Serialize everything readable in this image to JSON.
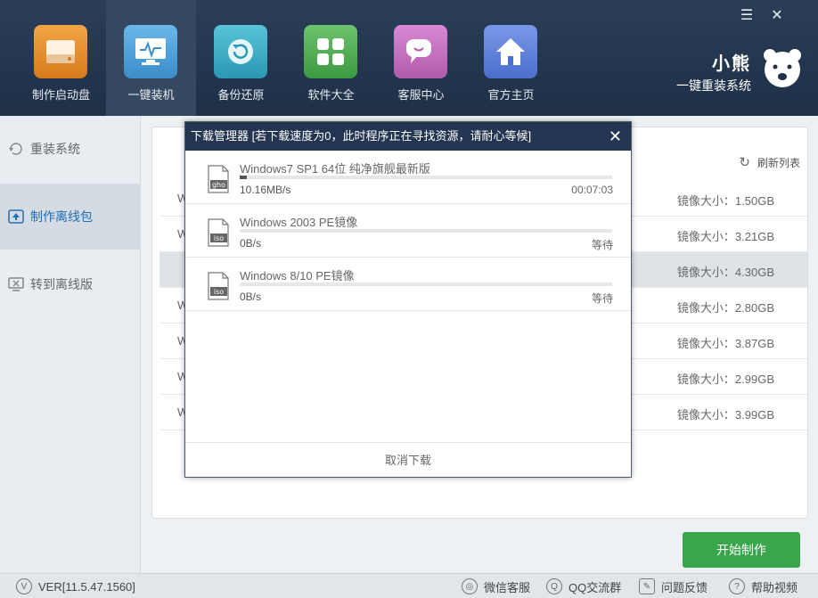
{
  "window": {
    "menu_icon": "hamburger-menu-icon",
    "close_icon": "close-icon"
  },
  "nav": [
    {
      "label": "制作启动盘",
      "icon": "drive-icon",
      "color": "#e28a2a",
      "active": false
    },
    {
      "label": "一键装机",
      "icon": "monitor-icon",
      "color": "#4a9fd8",
      "active": true
    },
    {
      "label": "备份还原",
      "icon": "restore-icon",
      "color": "#3bb0c9",
      "active": false
    },
    {
      "label": "软件大全",
      "icon": "apps-icon",
      "color": "#4caf50",
      "active": false
    },
    {
      "label": "客服中心",
      "icon": "chat-icon",
      "color": "#c86cc0",
      "active": false
    },
    {
      "label": "官方主页",
      "icon": "home-icon",
      "color": "#5a7fd6",
      "active": false
    }
  ],
  "brand": {
    "name": "小熊",
    "tagline": "一键重装系统"
  },
  "sidebar": [
    {
      "label": "重装系统",
      "icon": "reinstall-icon",
      "active": false
    },
    {
      "label": "制作离线包",
      "icon": "upload-icon",
      "active": true
    },
    {
      "label": "转到离线版",
      "icon": "offline-icon",
      "active": false
    }
  ],
  "list": {
    "refresh_label": "刷新列表",
    "rows": [
      {
        "prefix": "W",
        "size": "镜像大小：1.50GB"
      },
      {
        "prefix": "W",
        "size": "镜像大小：3.21GB"
      },
      {
        "prefix": "",
        "size": "镜像大小：4.30GB"
      },
      {
        "prefix": "W",
        "size": "镜像大小：2.80GB"
      },
      {
        "prefix": "W",
        "size": "镜像大小：3.87GB"
      },
      {
        "prefix": "W",
        "size": "镜像大小：2.99GB"
      },
      {
        "prefix": "W",
        "size": "镜像大小：3.99GB"
      }
    ]
  },
  "start_button": "开始制作",
  "status_bar": {
    "version": "VER[11.5.47.1560]",
    "wechat": "微信客服",
    "qq": "QQ交流群",
    "feedback": "问题反馈",
    "help": "帮助视频"
  },
  "dialog": {
    "title": "下载管理器 [若下载速度为0，此时程序正在寻找资源，请耐心等候]",
    "close": "✕",
    "items": [
      {
        "name": "Windows7 SP1 64位 纯净旗舰最新版",
        "type": "gho",
        "speed": "10.16MB/s",
        "status": "00:07:03",
        "progress": 0.02
      },
      {
        "name": "Windows 2003 PE镜像",
        "type": "iso",
        "speed": "0B/s",
        "status": "等待",
        "progress": 0
      },
      {
        "name": "Windows 8/10 PE镜像",
        "type": "iso",
        "speed": "0B/s",
        "status": "等待",
        "progress": 0
      }
    ],
    "cancel": "取消下载"
  }
}
